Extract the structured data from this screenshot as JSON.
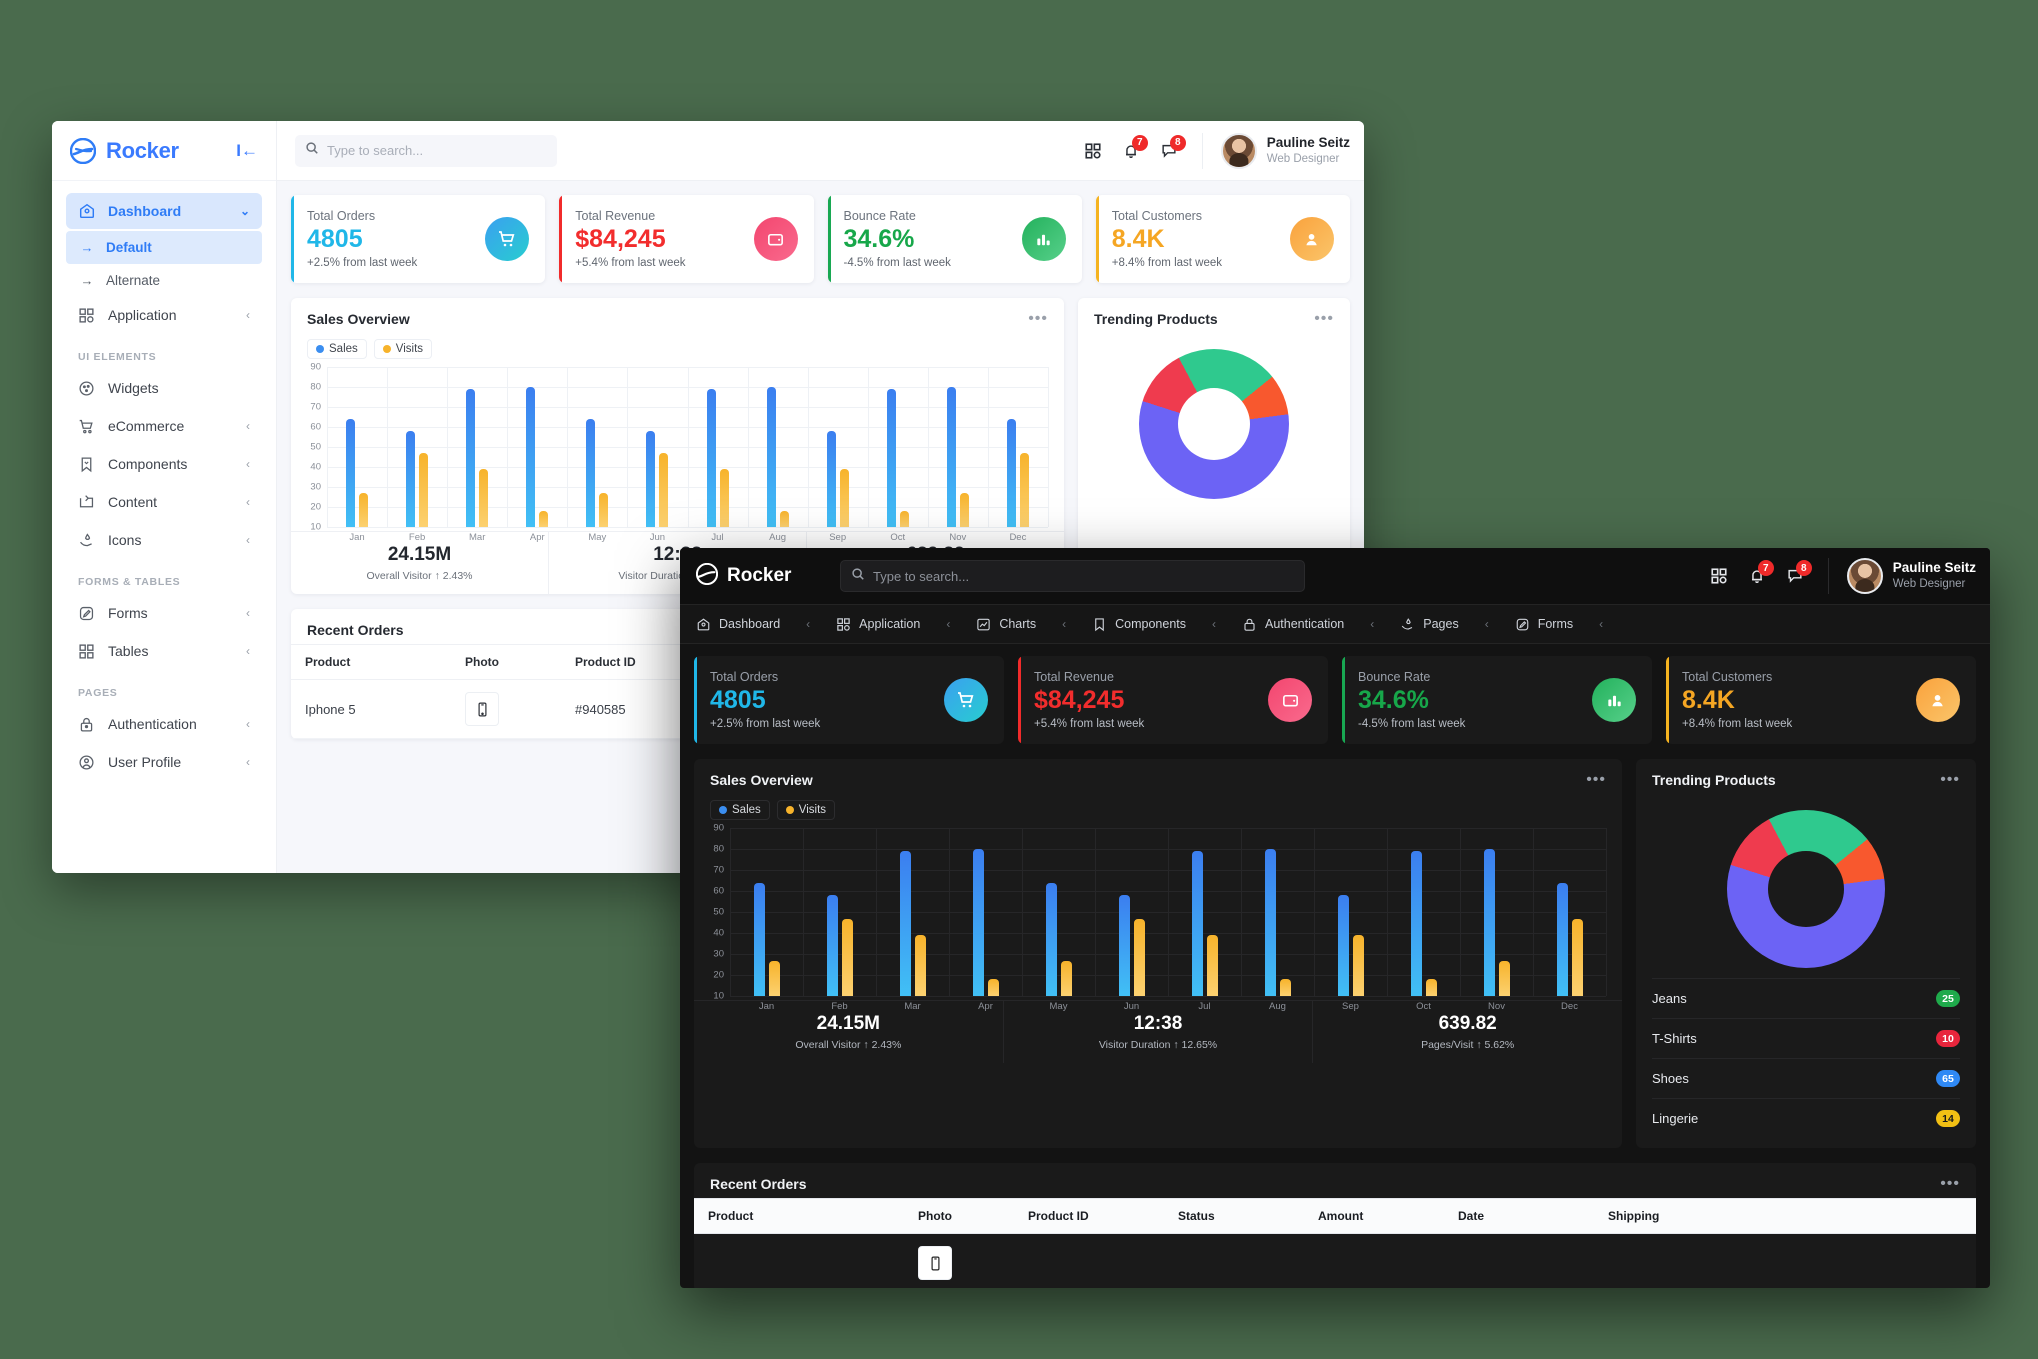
{
  "brand": {
    "name": "Rocker",
    "collapse_icon": "collapse-left-icon"
  },
  "search": {
    "placeholder": "Type to search...",
    "icon": "search-icon"
  },
  "header": {
    "grid_icon": "apps-grid-icon",
    "bell_icon": "bell-icon",
    "bell_badge": "7",
    "chat_icon": "chat-bubble-icon",
    "chat_badge": "8",
    "user_name": "Pauline Seitz",
    "user_role": "Web Designer"
  },
  "sidebar": {
    "items": [
      {
        "label": "Dashboard",
        "icon": "home-icon",
        "active": true,
        "chevron": "chevron-down-icon"
      },
      {
        "label": "Default",
        "icon": "arrow-right-icon",
        "sub": true,
        "selected": true
      },
      {
        "label": "Alternate",
        "icon": "arrow-right-icon",
        "sub": true,
        "selected": false
      },
      {
        "label": "Application",
        "icon": "apps-grid-icon",
        "chevron": "chevron-left-icon"
      }
    ],
    "group_ui": "UI ELEMENTS",
    "ui_items": [
      {
        "label": "Widgets",
        "icon": "cookie-icon",
        "chevron": ""
      },
      {
        "label": "eCommerce",
        "icon": "cart-icon",
        "chevron": "chevron-left-icon"
      },
      {
        "label": "Components",
        "icon": "bookmark-icon",
        "chevron": "chevron-left-icon"
      },
      {
        "label": "Content",
        "icon": "content-icon",
        "chevron": "chevron-left-icon"
      },
      {
        "label": "Icons",
        "icon": "hand-drop-icon",
        "chevron": "chevron-left-icon"
      }
    ],
    "group_forms": "FORMS & TABLES",
    "form_items": [
      {
        "label": "Forms",
        "icon": "pencil-square-icon",
        "chevron": "chevron-left-icon"
      },
      {
        "label": "Tables",
        "icon": "apps-grid-icon",
        "chevron": "chevron-left-icon"
      }
    ],
    "group_pages": "PAGES",
    "page_items": [
      {
        "label": "Authentication",
        "icon": "lock-icon",
        "chevron": "chevron-left-icon"
      },
      {
        "label": "User Profile",
        "icon": "user-circle-icon",
        "chevron": "chevron-left-icon"
      }
    ]
  },
  "topnav": {
    "items": [
      {
        "label": "Dashboard",
        "icon": "home-icon"
      },
      {
        "label": "Application",
        "icon": "apps-grid-icon"
      },
      {
        "label": "Charts",
        "icon": "chart-line-icon"
      },
      {
        "label": "Components",
        "icon": "bookmark-icon"
      },
      {
        "label": "Authentication",
        "icon": "lock-icon"
      },
      {
        "label": "Pages",
        "icon": "hand-drop-icon"
      },
      {
        "label": "Forms",
        "icon": "pencil-square-icon"
      }
    ],
    "separator": "‹"
  },
  "stats": [
    {
      "label": "Total Orders",
      "value": "4805",
      "delta": "+2.5% from last week",
      "accent": "#20b7e8",
      "icon": "cart-icon",
      "tone": "blue"
    },
    {
      "label": "Total Revenue",
      "value": "$84,245",
      "delta": "+5.4% from last week",
      "accent": "#f12b2b",
      "icon": "wallet-icon",
      "tone": "red"
    },
    {
      "label": "Bounce Rate",
      "value": "34.6%",
      "delta": "-4.5% from last week",
      "accent": "#18a852",
      "icon": "bar-chart-icon",
      "tone": "green"
    },
    {
      "label": "Total Customers",
      "value": "8.4K",
      "delta": "+8.4% from last week",
      "accent": "#f5b320",
      "icon": "user-icon",
      "tone": "amber"
    }
  ],
  "sales_panel": {
    "title": "Sales Overview",
    "menu_icon": "more-horizontal-icon",
    "legend": [
      {
        "label": "Sales",
        "color": "#3b8ef0"
      },
      {
        "label": "Visits",
        "color": "#f7b32b"
      }
    ]
  },
  "chart_data": {
    "type": "bar",
    "title": "Sales Overview",
    "categories": [
      "Jan",
      "Feb",
      "Mar",
      "Apr",
      "May",
      "Jun",
      "Jul",
      "Aug",
      "Sep",
      "Oct",
      "Nov",
      "Dec"
    ],
    "series": [
      {
        "name": "Sales",
        "color": "#3b8ef0",
        "values": [
          64,
          58,
          79,
          80,
          64,
          58,
          79,
          80,
          58,
          79,
          80,
          64
        ]
      },
      {
        "name": "Visits",
        "color": "#f7b32b",
        "values": [
          27,
          47,
          39,
          18,
          27,
          47,
          39,
          18,
          39,
          18,
          27,
          47
        ]
      }
    ],
    "ylim": [
      10,
      90
    ],
    "yticks": [
      90,
      80,
      70,
      60,
      50,
      40,
      30,
      20,
      10
    ],
    "xlabel": "",
    "ylabel": "",
    "grid": true,
    "legend_position": "top-left"
  },
  "mini_stats": [
    {
      "value": "24.15M",
      "label": "Overall Visitor",
      "arrow": "↑",
      "change": "2.43%"
    },
    {
      "value": "12:38",
      "label": "Visitor Duration",
      "arrow": "↑",
      "change": "12.65%"
    },
    {
      "value": "639.82",
      "label": "Pages/Visit",
      "arrow": "↑",
      "change": "5.62%"
    }
  ],
  "trending": {
    "title": "Trending Products",
    "menu_icon": "more-horizontal-icon",
    "donut": {
      "type": "pie",
      "slices": [
        {
          "name": "Jeans",
          "value": 25,
          "color": "#2fc98e"
        },
        {
          "name": "T-Shirts",
          "value": 10,
          "color": "#f8582e"
        },
        {
          "name": "Shoes",
          "value": 65,
          "color": "#6c63f5"
        },
        {
          "name": "Lingerie",
          "value": 14,
          "color": "#ef3b4e"
        }
      ]
    },
    "items": [
      {
        "label": "Jeans",
        "badge": "25",
        "badge_color": "#1faa4b"
      },
      {
        "label": "T-Shirts",
        "badge": "10",
        "badge_color": "#e8253c"
      },
      {
        "label": "Shoes",
        "badge": "65",
        "badge_color": "#2f89f5"
      },
      {
        "label": "Lingerie",
        "badge": "14",
        "badge_color": "#f2c014"
      }
    ]
  },
  "orders": {
    "title": "Recent Orders",
    "menu_icon": "more-horizontal-icon",
    "columns": [
      "Product",
      "Photo",
      "Product ID",
      "Status",
      "Amount",
      "Date",
      "Shipping"
    ],
    "rows": [
      {
        "product": "Iphone 5",
        "photo": "phone-icon",
        "product_id": "#940585",
        "status": "",
        "amount": "",
        "date": "",
        "shipping": ""
      }
    ]
  }
}
